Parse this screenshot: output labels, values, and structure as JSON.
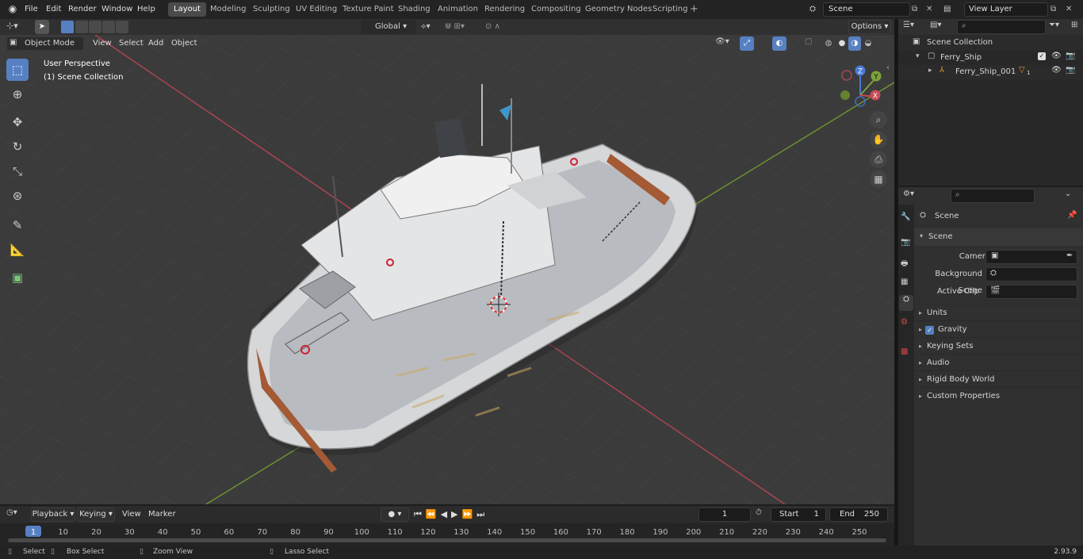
{
  "app": {
    "menus": [
      "File",
      "Edit",
      "Render",
      "Window",
      "Help"
    ],
    "workspaces": [
      "Layout",
      "Modeling",
      "Sculpting",
      "UV Editing",
      "Texture Paint",
      "Shading",
      "Animation",
      "Rendering",
      "Compositing",
      "Geometry Nodes",
      "Scripting"
    ],
    "active_workspace": "Layout",
    "scene_name": "Scene",
    "view_layer": "View Layer"
  },
  "viewport": {
    "mode": "Object Mode",
    "menus": [
      "View",
      "Select",
      "Add",
      "Object"
    ],
    "transform": "Global",
    "options_label": "Options",
    "overlay_text_1": "User Perspective",
    "overlay_text_2": "(1) Scene Collection",
    "gizmo": {
      "z": "Z",
      "y": "Y",
      "x": "X"
    }
  },
  "outliner": {
    "root": "Scene Collection",
    "items": [
      {
        "label": "Ferry_Ship",
        "depth": 1
      },
      {
        "label": "Ferry_Ship_001",
        "depth": 2,
        "badge": "1"
      }
    ]
  },
  "properties": {
    "context": "Scene",
    "section": "Scene",
    "fields": [
      {
        "label": "Camera"
      },
      {
        "label": "Background Scene"
      },
      {
        "label": "Active Clip"
      }
    ],
    "panels": [
      "Units",
      "Gravity",
      "Keying Sets",
      "Audio",
      "Rigid Body World",
      "Custom Properties"
    ],
    "gravity_checked": true
  },
  "timeline": {
    "menus": [
      "Playback",
      "Keying",
      "View",
      "Marker"
    ],
    "current_frame": "1",
    "start_label": "Start",
    "start": "1",
    "end_label": "End",
    "end": "250",
    "ticks": [
      "1",
      "10",
      "20",
      "30",
      "40",
      "50",
      "60",
      "70",
      "80",
      "90",
      "100",
      "110",
      "120",
      "130",
      "140",
      "150",
      "160",
      "170",
      "180",
      "190",
      "200",
      "210",
      "220",
      "230",
      "240",
      "250"
    ]
  },
  "statusbar": {
    "items": [
      "Select",
      "Box Select",
      "Zoom View",
      "Lasso Select"
    ],
    "version": "2.93.9"
  },
  "colors": {
    "accent": "#5680c2",
    "x_axis": "#c94a55",
    "y_axis": "#7ea33a",
    "z_axis": "#4a79d6"
  }
}
